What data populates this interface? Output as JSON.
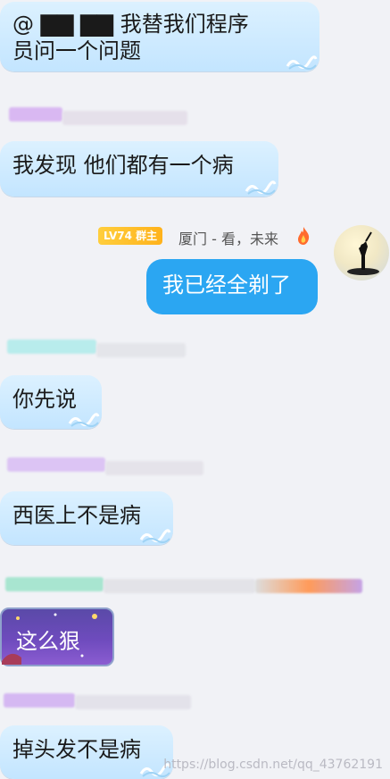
{
  "messages": [
    {
      "id": "m1",
      "text_line1": "@ ▇▇ ▇▇ 我替我们程序",
      "text_line2": "员问一个问题"
    },
    {
      "id": "m2",
      "text": "我发现  他们都有一个病"
    },
    {
      "id": "m3",
      "text": "我已经全剃了"
    },
    {
      "id": "m4",
      "text": "你先说"
    },
    {
      "id": "m5",
      "text": "西医上不是病"
    },
    {
      "id": "m6",
      "text": "这么狠"
    },
    {
      "id": "m7",
      "text": "掉头发不是病"
    }
  ],
  "sender": {
    "level": "LV74",
    "role": "群主",
    "name": "厦门 - 看，未来",
    "flame_icon": "flame-icon"
  },
  "watermark": "https://blog.csdn.net/qq_43762191",
  "colors": {
    "bubble": "#c3e5ff",
    "my_bubble": "#2ba6f2",
    "badge": "#ffb21b",
    "background": "#f1f2f6"
  }
}
